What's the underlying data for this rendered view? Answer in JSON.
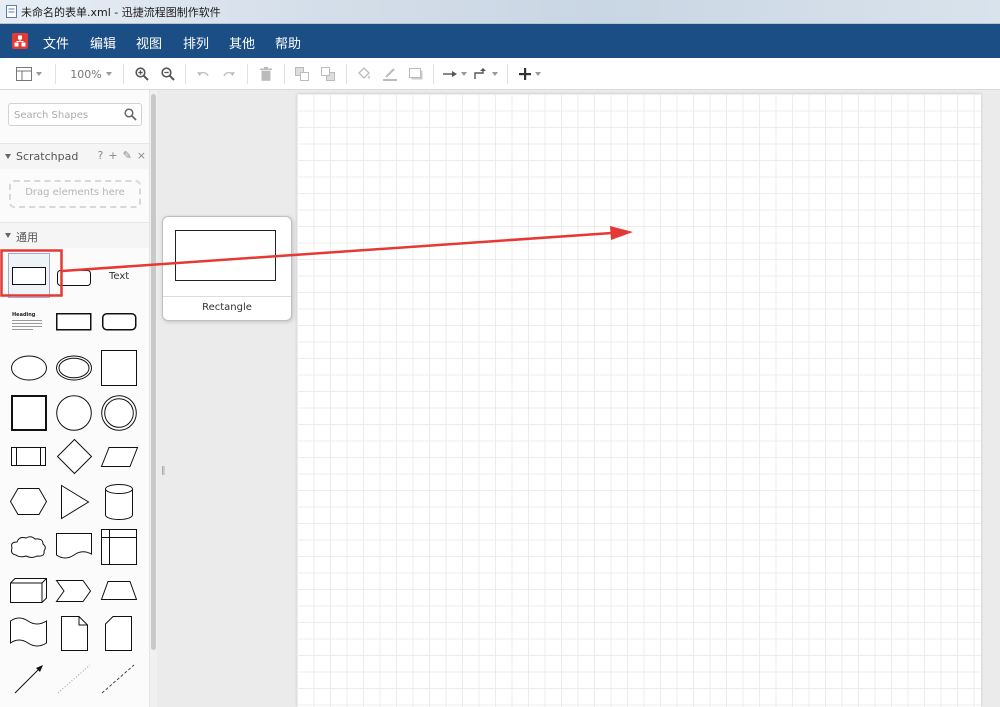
{
  "window": {
    "title": "未命名的表单.xml - 迅捷流程图制作软件"
  },
  "menu": {
    "items": [
      "文件",
      "编辑",
      "视图",
      "排列",
      "其他",
      "帮助"
    ]
  },
  "toolbar": {
    "zoom_level": "100%"
  },
  "sidebar": {
    "search_placeholder": "Search Shapes",
    "scratchpad": {
      "label": "Scratchpad",
      "help": "?",
      "add": "+",
      "edit": "✎",
      "close": "×",
      "dropzone_text": "Drag elements here"
    },
    "general": {
      "label": "通用",
      "text_shape": "Text",
      "heading_shape": "Heading"
    }
  },
  "tooltip": {
    "label": "Rectangle"
  },
  "colors": {
    "menubar": "#1c4e86",
    "highlight": "#e53935",
    "arrow": "#e53935"
  }
}
